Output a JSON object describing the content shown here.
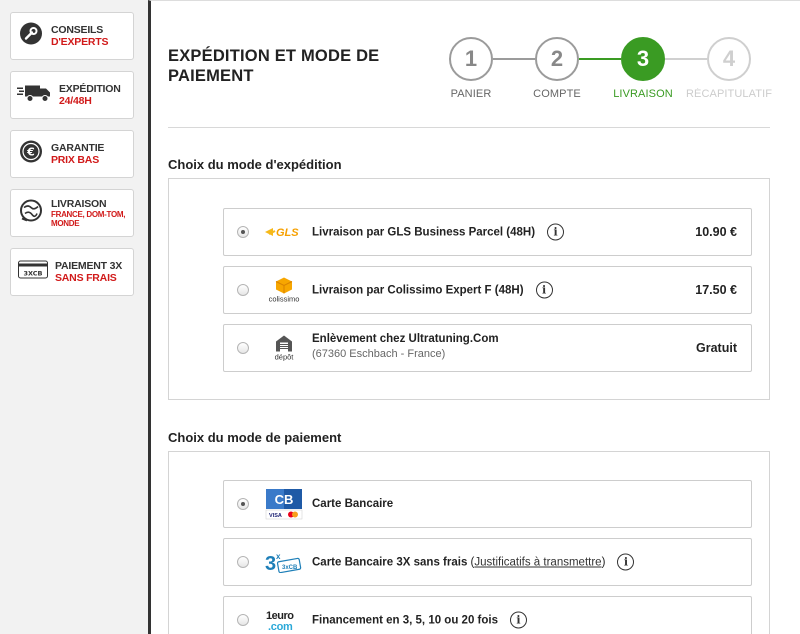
{
  "sidebar": {
    "cards": [
      {
        "line1": "CONSEILS",
        "line2": "D'EXPERTS",
        "icon": "wrench-icon"
      },
      {
        "line1": "EXPÉDITION",
        "line2": "24/48H",
        "icon": "truck-icon"
      },
      {
        "line1": "GARANTIE",
        "line2": "PRIX BAS",
        "icon": "euro-icon"
      },
      {
        "line1": "LIVRAISON",
        "line2": "FRANCE, DOM-TOM, MONDE",
        "icon": "globe-icon"
      },
      {
        "line1": "PAIEMENT 3X",
        "line2": "SANS FRAIS",
        "icon": "card-3xcb-icon",
        "badge": "3XCB"
      }
    ]
  },
  "page": {
    "title": "EXPÉDITION ET MODE DE PAIEMENT"
  },
  "stepper": {
    "steps": [
      {
        "number": "1",
        "label": "PANIER",
        "state": "done"
      },
      {
        "number": "2",
        "label": "COMPTE",
        "state": "done"
      },
      {
        "number": "3",
        "label": "LIVRAISON",
        "state": "active"
      },
      {
        "number": "4",
        "label": "RÉCAPITULATIF",
        "state": "future"
      }
    ],
    "colors": {
      "active": "#3a9b23",
      "done": "#9b9b9b",
      "future": "#cfcfcf"
    }
  },
  "shipping": {
    "title": "Choix du mode d'expédition",
    "options": [
      {
        "logo": "GLS",
        "label": "Livraison par GLS Business Parcel (48H)",
        "price": "10.90 €",
        "selected": true
      },
      {
        "logo": "colissimo",
        "label": "Livraison par Colissimo Expert F (48H)",
        "price": "17.50 €",
        "selected": false
      },
      {
        "logo": "dépôt",
        "label": "Enlèvement chez Ultratuning.Com",
        "sublabel": "(67360 Eschbach - France)",
        "price": "Gratuit",
        "selected": false
      }
    ]
  },
  "payment": {
    "title": "Choix du mode de paiement",
    "options": [
      {
        "logo": "CB",
        "label": "Carte Bancaire",
        "selected": true
      },
      {
        "logo": "3xCB",
        "label": "Carte Bancaire 3X sans frais",
        "link": "Justificatifs à transmettre",
        "selected": false
      },
      {
        "logo": "1euro.com",
        "label": "Financement en 3, 5, 10 ou 20 fois",
        "selected": false
      }
    ]
  },
  "info_glyph": "i"
}
